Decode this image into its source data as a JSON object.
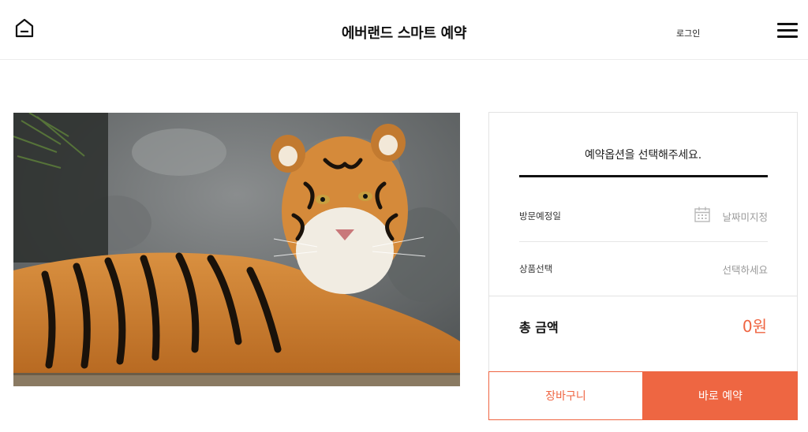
{
  "header": {
    "title": "에버랜드 스마트 예약",
    "login_label": "로그인",
    "home_icon": "home-icon",
    "menu_icon": "hamburger-icon"
  },
  "photo": {
    "subject": "tiger-photo"
  },
  "panel": {
    "heading": "예약옵션을 선택해주세요.",
    "options": [
      {
        "label": "방문예정일",
        "value": "날짜미지정",
        "icon": "calendar-icon"
      },
      {
        "label": "상품선택",
        "value": "선택하세요"
      }
    ],
    "total_label": "총 금액",
    "total_value": "0원"
  },
  "actions": {
    "cart_label": "장바구니",
    "book_label": "바로 예약"
  },
  "colors": {
    "accent": "#ee6642",
    "text": "#111111",
    "muted": "#9a9a9a"
  }
}
